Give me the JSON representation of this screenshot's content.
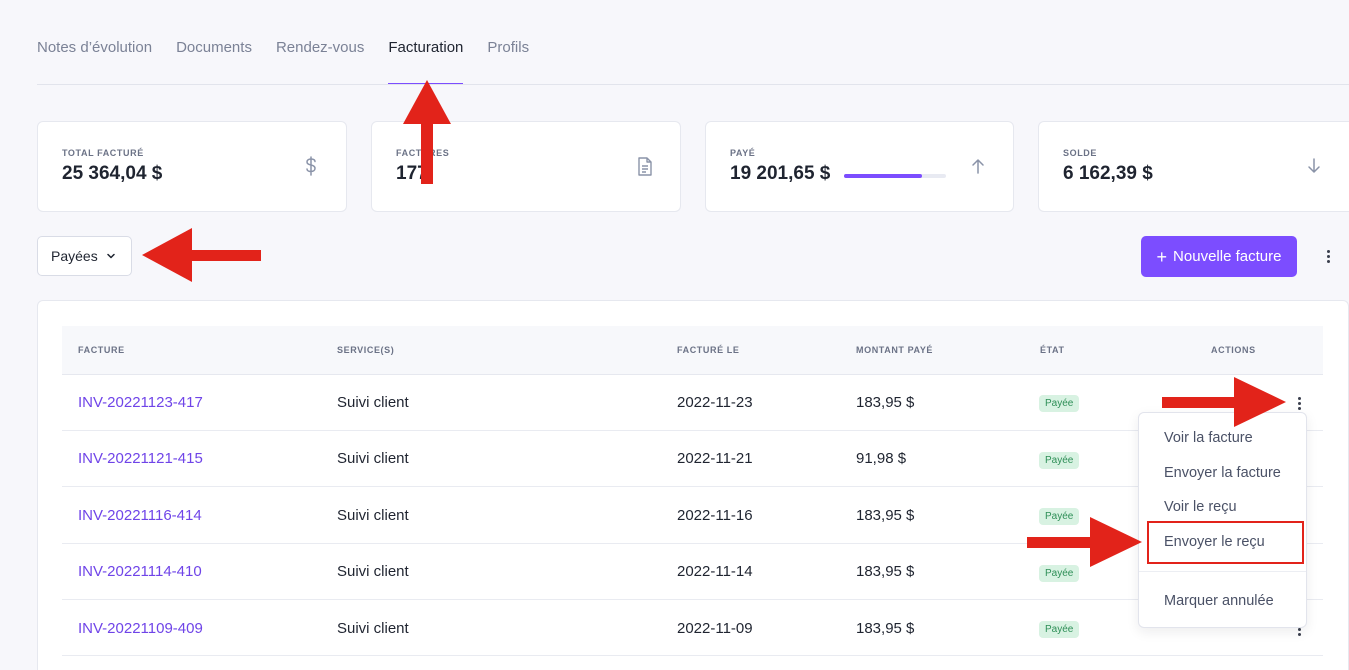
{
  "tabs": [
    {
      "label": "Notes d’évolution",
      "active": false
    },
    {
      "label": "Documents",
      "active": false
    },
    {
      "label": "Rendez-vous",
      "active": false
    },
    {
      "label": "Facturation",
      "active": true
    },
    {
      "label": "Profils",
      "active": false
    }
  ],
  "stats": {
    "total": {
      "label": "TOTAL FACTURÉ",
      "value": "25 364,04 $",
      "icon": "dollar-icon"
    },
    "factures": {
      "label": "FACTURES",
      "value": "177",
      "icon": "document-icon"
    },
    "paye": {
      "label": "PAYÉ",
      "value": "19 201,65 $",
      "progress": 0.76,
      "icon": "arrow-up-icon"
    },
    "solde": {
      "label": "SOLDE",
      "value": "6 162,39 $",
      "icon": "arrow-down-icon"
    }
  },
  "filter": {
    "selected": "Payées"
  },
  "new_invoice": {
    "label": "Nouvelle facture"
  },
  "table": {
    "headers": {
      "facture": "FACTURE",
      "services": "SERVICE(S)",
      "facture_le": "FACTURÉ LE",
      "montant": "MONTANT PAYÉ",
      "etat": "ÉTAT",
      "actions": "ACTIONS"
    },
    "rows": [
      {
        "invoice": "INV-20221123-417",
        "service": "Suivi client",
        "date": "2022-11-23",
        "amount": "183,95 $",
        "status": "Payée"
      },
      {
        "invoice": "INV-20221121-415",
        "service": "Suivi client",
        "date": "2022-11-21",
        "amount": "91,98 $",
        "status": "Payée"
      },
      {
        "invoice": "INV-20221116-414",
        "service": "Suivi client",
        "date": "2022-11-16",
        "amount": "183,95 $",
        "status": "Payée"
      },
      {
        "invoice": "INV-20221114-410",
        "service": "Suivi client",
        "date": "2022-11-14",
        "amount": "183,95 $",
        "status": "Payée"
      },
      {
        "invoice": "INV-20221109-409",
        "service": "Suivi client",
        "date": "2022-11-09",
        "amount": "183,95 $",
        "status": "Payée"
      }
    ]
  },
  "actions_menu": {
    "items": [
      "Voir la facture",
      "Envoyer la facture",
      "Voir le reçu",
      "Envoyer le reçu",
      "Marquer annulée"
    ],
    "highlighted": "Envoyer le reçu"
  },
  "colors": {
    "accent": "#7c4dff",
    "annotation": "#e2231a",
    "paid_badge_bg": "#d8f2e2",
    "paid_badge_text": "#2e8f57"
  }
}
